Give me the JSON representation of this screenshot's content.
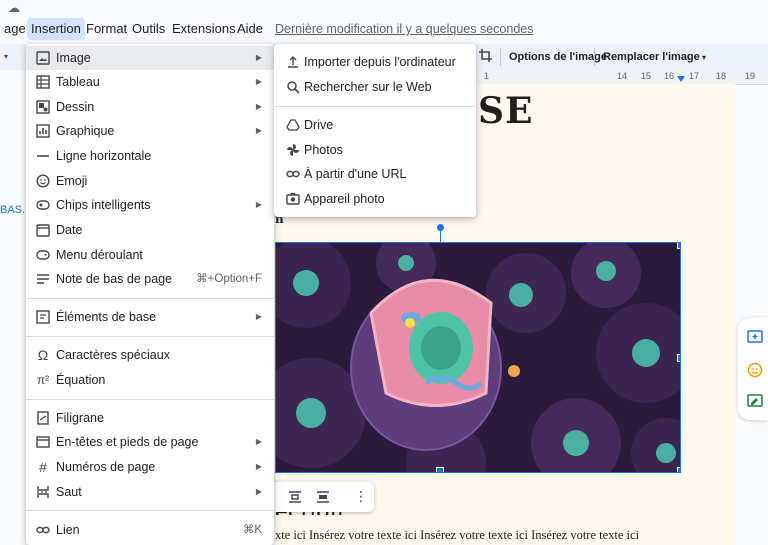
{
  "menubar": {
    "items": [
      "age",
      "Insertion",
      "Format",
      "Outils",
      "Extensions",
      "Aide"
    ],
    "last_modified": "Dernière modification il y a quelques secondes"
  },
  "toolbar": {
    "image_options": "Options de l'image",
    "replace_image": "Remplacer l'image"
  },
  "ruler": {
    "numbers": [
      "1",
      "14",
      "15",
      "16",
      "17",
      "18",
      "19"
    ]
  },
  "left_fragment": "BAS...",
  "document": {
    "heading_fragment": "SE",
    "text_fragment": "n",
    "title_fragment": "ection",
    "body_line": "xte ici Insérez votre texte ici Insérez votre texte ici Insérez votre texte ici"
  },
  "insert_menu": {
    "items": [
      {
        "label": "Image",
        "icon": "image-icon",
        "submenu": true
      },
      {
        "label": "Tableau",
        "icon": "table-icon",
        "submenu": true
      },
      {
        "label": "Dessin",
        "icon": "drawing-icon",
        "submenu": true
      },
      {
        "label": "Graphique",
        "icon": "chart-icon",
        "submenu": true
      },
      {
        "label": "Ligne horizontale",
        "icon": "horizontal-line-icon",
        "submenu": false
      },
      {
        "label": "Emoji",
        "icon": "emoji-icon",
        "submenu": false
      },
      {
        "label": "Chips intelligents",
        "icon": "smart-chips-icon",
        "submenu": true
      },
      {
        "label": "Date",
        "icon": "date-icon",
        "submenu": false
      },
      {
        "label": "Menu déroulant",
        "icon": "dropdown-icon",
        "submenu": false
      },
      {
        "label": "Note de bas de page",
        "icon": "footnote-icon",
        "submenu": false,
        "shortcut": "⌘+Option+F"
      },
      {
        "label": "Éléments de base",
        "icon": "building-blocks-icon",
        "submenu": true
      },
      {
        "label": "Caractères spéciaux",
        "icon": "omega-icon",
        "submenu": false
      },
      {
        "label": "Équation",
        "icon": "equation-icon",
        "submenu": false
      },
      {
        "label": "Filigrane",
        "icon": "watermark-icon",
        "submenu": false
      },
      {
        "label": "En-têtes et pieds de page",
        "icon": "header-footer-icon",
        "submenu": true
      },
      {
        "label": "Numéros de page",
        "icon": "hash-icon",
        "submenu": true
      },
      {
        "label": "Saut",
        "icon": "break-icon",
        "submenu": true
      },
      {
        "label": "Lien",
        "icon": "link-icon",
        "submenu": false,
        "shortcut": "⌘K"
      }
    ]
  },
  "image_submenu": {
    "items": [
      {
        "label": "Importer depuis l'ordinateur",
        "icon": "upload-icon"
      },
      {
        "label": "Rechercher sur le Web",
        "icon": "search-icon"
      },
      {
        "label": "Drive",
        "icon": "drive-icon"
      },
      {
        "label": "Photos",
        "icon": "photos-icon"
      },
      {
        "label": "À partir d'une URL",
        "icon": "link-icon"
      },
      {
        "label": "Appareil photo",
        "icon": "camera-icon"
      }
    ]
  },
  "colors": {
    "accent": "#1a73e8",
    "menu_highlight": "#e8eaed",
    "page_background": "#fff8ef"
  }
}
